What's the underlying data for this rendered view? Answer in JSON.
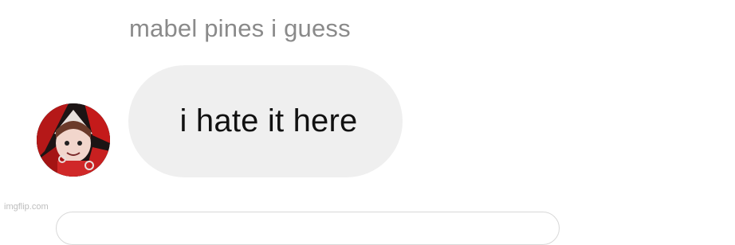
{
  "message": {
    "sender_name": "mabel pines i guess",
    "text": "i hate it here",
    "avatar_icon": "profile-avatar"
  },
  "watermark": "imgflip.com",
  "colors": {
    "bubble": "#efefef",
    "sender_name": "#8a8a8a",
    "message_text": "#111111",
    "avatar_accent": "#c41a1a"
  }
}
